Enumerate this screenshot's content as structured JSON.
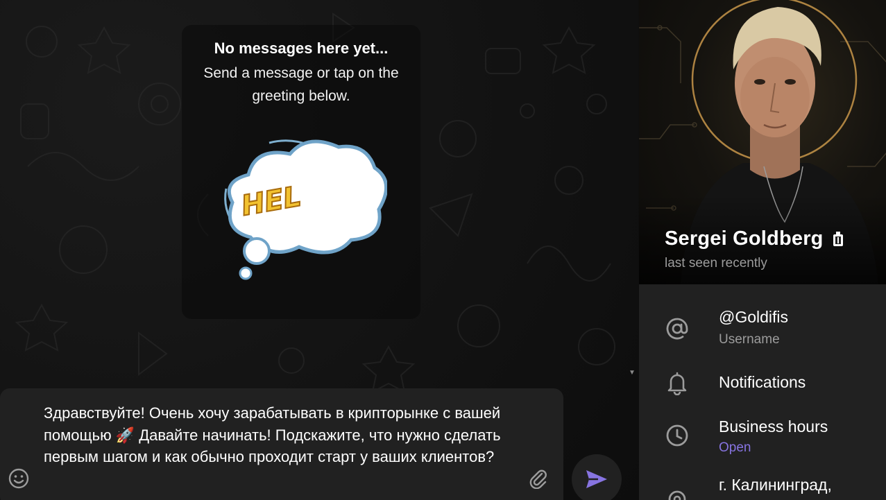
{
  "chat": {
    "empty_title": "No messages here yet...",
    "empty_subtitle": "Send a message or tap on the greeting below.",
    "sticker_text": "HEL",
    "composer_text": "Здравствуйте! Очень хочу зарабатывать в крипторынке с вашей помощью 🚀 Давайте начинать! Подскажите, что нужно сделать первым шагом и как обычно проходит старт у ваших клиентов?",
    "icons": {
      "emoji": "smile-icon",
      "attach": "paperclip-icon",
      "send": "send-icon"
    }
  },
  "profile": {
    "name": "Sergei Goldberg",
    "badge_icon": "premium-badge-icon",
    "status": "last seen recently",
    "rows": [
      {
        "icon": "at-icon",
        "main": "@Goldifis",
        "sub": "Username"
      },
      {
        "icon": "bell-icon",
        "main": "Notifications",
        "sub": ""
      },
      {
        "icon": "clock-icon",
        "main": "Business hours",
        "sub": "Open"
      },
      {
        "icon": "location-icon",
        "main": "г. Калининград,",
        "sub": ""
      }
    ]
  },
  "colors": {
    "accent": "#8774e1",
    "panel_bg": "#212121",
    "muted_text": "#9c9c9c"
  }
}
